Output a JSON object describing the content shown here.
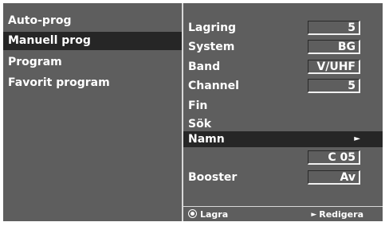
{
  "left_menu": {
    "items": [
      {
        "label": "Auto-prog",
        "selected": false
      },
      {
        "label": "Manuell prog",
        "selected": true
      },
      {
        "label": "Program",
        "selected": false
      },
      {
        "label": "Favorit program",
        "selected": false
      }
    ]
  },
  "right_menu": {
    "lagring": {
      "label": "Lagring",
      "value": "5"
    },
    "system": {
      "label": "System",
      "value": "BG"
    },
    "band": {
      "label": "Band",
      "value": "V/UHF"
    },
    "channel": {
      "label": "Channel",
      "value": "5"
    },
    "fin": {
      "label": "Fin"
    },
    "sok": {
      "label": "Sök"
    },
    "namn": {
      "label": "Namn",
      "arrow": "►",
      "value": "C 05"
    },
    "booster": {
      "label": "Booster",
      "value": "Av"
    }
  },
  "footer": {
    "store_label": "Lagra",
    "edit_label": "Redigera"
  },
  "colors": {
    "panel": "#5e5e5e",
    "highlight": "#262626",
    "text": "#ffffff",
    "divider": "#d8d8d8"
  },
  "icons": {
    "store": "radio-dot-icon",
    "edit": "triangle-right-icon",
    "namn_arrow": "triangle-right-icon"
  }
}
